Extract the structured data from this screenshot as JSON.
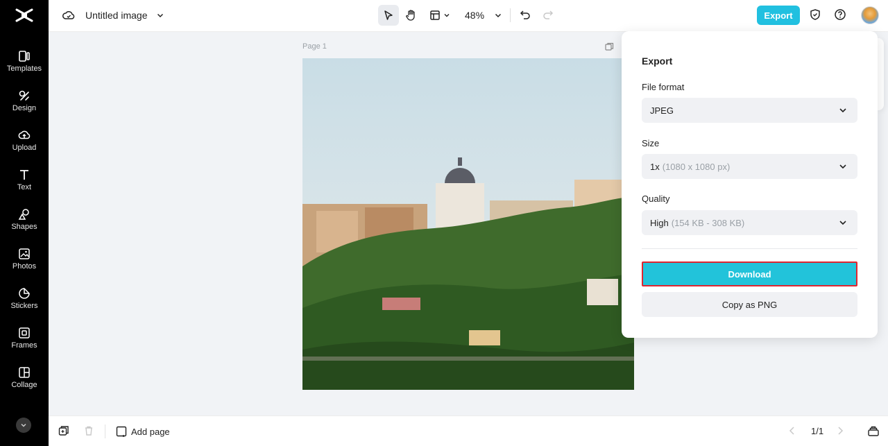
{
  "app": {
    "title": "Untitled image",
    "zoom": "48%",
    "export_label": "Export"
  },
  "sidebar": {
    "items": [
      {
        "label": "Templates",
        "icon": "templates-icon"
      },
      {
        "label": "Design",
        "icon": "design-icon"
      },
      {
        "label": "Upload",
        "icon": "upload-icon"
      },
      {
        "label": "Text",
        "icon": "text-icon"
      },
      {
        "label": "Shapes",
        "icon": "shapes-icon"
      },
      {
        "label": "Photos",
        "icon": "photos-icon"
      },
      {
        "label": "Stickers",
        "icon": "stickers-icon"
      },
      {
        "label": "Frames",
        "icon": "frames-icon"
      },
      {
        "label": "Collage",
        "icon": "collage-icon"
      }
    ]
  },
  "canvas": {
    "page_label": "Page 1"
  },
  "bottom": {
    "add_page": "Add page",
    "pager": "1/1"
  },
  "export_panel": {
    "title": "Export",
    "format_label": "File format",
    "format_value": "JPEG",
    "size_label": "Size",
    "size_value": "1x",
    "size_hint": "(1080 x 1080 px)",
    "quality_label": "Quality",
    "quality_value": "High",
    "quality_hint": "(154 KB - 308 KB)",
    "download_label": "Download",
    "copy_label": "Copy as PNG"
  },
  "colors": {
    "accent": "#21c0e0",
    "sidebar_bg": "#000000",
    "highlight_border": "#e0252f"
  }
}
